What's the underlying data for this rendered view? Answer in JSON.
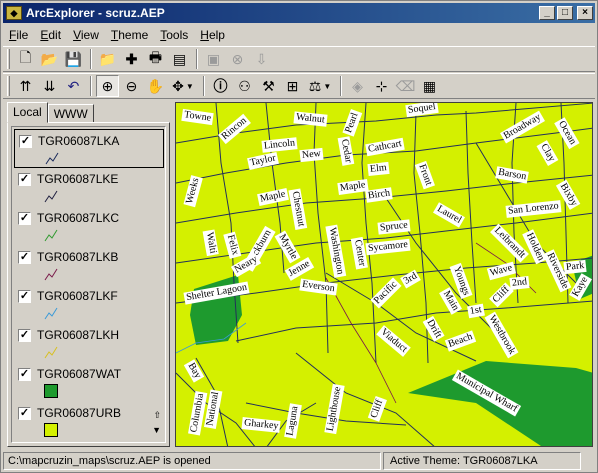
{
  "window": {
    "title": "ArcExplorer - scruz.AEP",
    "min": "_",
    "max": "□",
    "close": "×"
  },
  "menu": [
    "File",
    "Edit",
    "View",
    "Theme",
    "Tools",
    "Help"
  ],
  "tabs": {
    "local": "Local",
    "www": "WWW"
  },
  "layers": [
    {
      "name": "TGR06087LKA",
      "checked": true,
      "type": "line",
      "color": "#1a2a5a"
    },
    {
      "name": "TGR06087LKE",
      "checked": true,
      "type": "line",
      "color": "#202040"
    },
    {
      "name": "TGR06087LKC",
      "checked": true,
      "type": "line",
      "color": "#2f9a2f"
    },
    {
      "name": "TGR06087LKB",
      "checked": true,
      "type": "line",
      "color": "#7a1a4a"
    },
    {
      "name": "TGR06087LKF",
      "checked": true,
      "type": "line",
      "color": "#3a9ad8"
    },
    {
      "name": "TGR06087LKH",
      "checked": true,
      "type": "line",
      "color": "#d8c020"
    },
    {
      "name": "TGR06087WAT",
      "checked": true,
      "type": "fill",
      "color": "#1e9a2e"
    },
    {
      "name": "TGR06087URB",
      "checked": true,
      "type": "fill",
      "color": "#d4f000"
    }
  ],
  "map_labels": [
    "Towne",
    "Rincon",
    "Walnut",
    "Pearl",
    "Soquel",
    "Broadway",
    "Ocean",
    "Lincoln",
    "New",
    "Cedar",
    "Cathcart",
    "Elm",
    "Taylor",
    "Front",
    "Clay",
    "Barson",
    "Weeks",
    "Maple",
    "Chestnut",
    "Maple",
    "Birch",
    "Bixby",
    "Laurel",
    "San Lorenzo",
    "Spruce",
    "Walti",
    "Felix",
    "Blackburn",
    "Myrtle",
    "Jenne",
    "Washington",
    "Center",
    "Sycamore",
    "Leibrandt",
    "Holden",
    "Park",
    "Riverside",
    "Kaye",
    "Neary",
    "Wave",
    "2nd",
    "3rd",
    "Youngs",
    "Shelter Lagoon",
    "Everson",
    "Pacific",
    "Cliff",
    "Main",
    "1st",
    "Westbrook",
    "Drift",
    "Beach",
    "Viaduct",
    "Bay",
    "Municipal Wharf",
    "Columbia",
    "National",
    "Gharkey",
    "Laguna",
    "Lighthouse",
    "Cliff"
  ],
  "status": {
    "path": "C:\\mapcruzin_maps\\scruz.AEP is opened",
    "active_theme": "Active Theme: TGR06087LKA"
  }
}
